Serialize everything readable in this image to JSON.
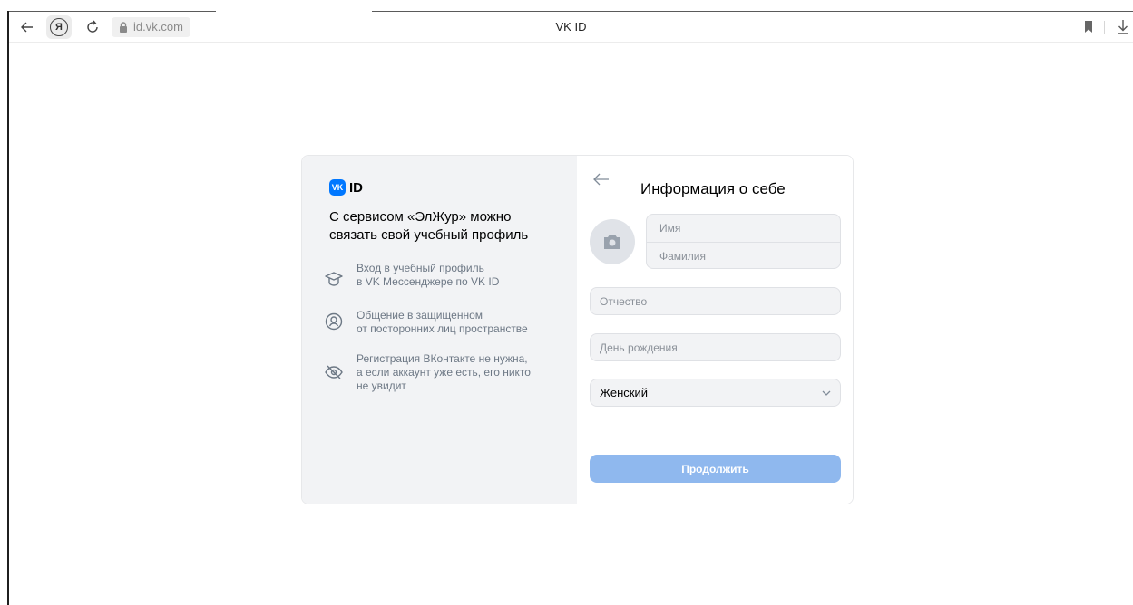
{
  "browser": {
    "url": "id.vk.com",
    "tab_title": "VK ID",
    "yandex_glyph": "Я",
    "icons": [
      "back-arrow-icon",
      "yandex-icon",
      "reload-icon",
      "lock-icon",
      "bookmark-icon",
      "download-icon"
    ]
  },
  "promo": {
    "logo_vk": "VK",
    "logo_id": "ID",
    "title": "С сервисом «ЭлЖур» можно связать свой учебный профиль",
    "features": [
      {
        "icon": "graduation-cap-icon",
        "text": "Вход в учебный профиль\nв VK Мессенджере по VK ID"
      },
      {
        "icon": "user-circle-icon",
        "text": "Общение в защищенном\nот посторонних лиц пространстве"
      },
      {
        "icon": "eye-off-icon",
        "text": "Регистрация ВКонтакте не нужна,\nа если аккаунт уже есть, его никто\nне увидит"
      }
    ]
  },
  "form": {
    "title": "Информация о себе",
    "first_name_placeholder": "Имя",
    "last_name_placeholder": "Фамилия",
    "patronymic_placeholder": "Отчество",
    "birthday_placeholder": "День рождения",
    "gender_value": "Женский",
    "submit_label": "Продолжить"
  },
  "colors": {
    "accent": "#0077ff",
    "button_disabled": "#8fb8ee",
    "panel_bg": "#f2f3f5"
  }
}
